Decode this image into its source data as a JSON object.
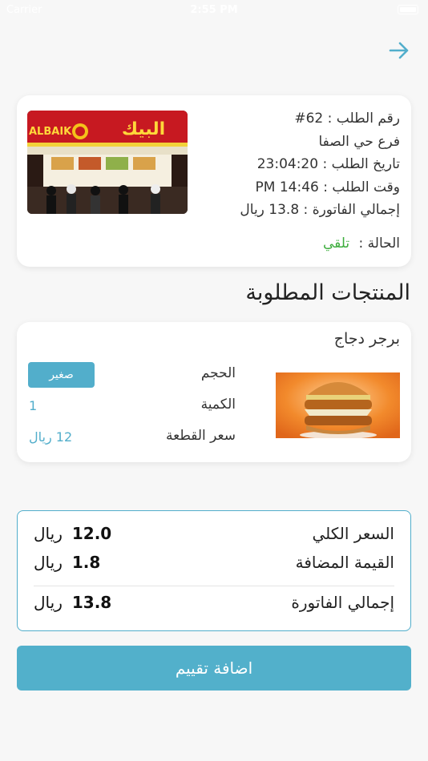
{
  "status_bar": {
    "carrier": "Carrier",
    "time": "2:55 PM"
  },
  "header": {
    "back_icon": "arrow-right-icon"
  },
  "order": {
    "number": "رقم الطلب : 62#",
    "branch": "فرع حي الصفا",
    "date": "تاريخ الطلب : 23:04:20",
    "time": "وقت الطلب : 14:46 PM",
    "total": "إجمالي الفاتورة : 13.8 ريال",
    "status_label": "الحالة :",
    "status_value": "تلقي",
    "status_color": "#3cad3c",
    "image_text": "البيك",
    "image_text_latin": "ALBAIK"
  },
  "products_section": {
    "title": "المنتجات المطلوبة"
  },
  "products": [
    {
      "name": "برجر دجاج",
      "size_label": "الحجم",
      "size_value": "صغير",
      "quantity_label": "الكمية",
      "quantity_value": "1",
      "unit_price_label": "سعر القطعة",
      "unit_price_value": "12 ريال"
    }
  ],
  "summary": {
    "subtotal_label": "السعر الكلي",
    "subtotal_value": "12.0",
    "vat_label": "القيمة المضافة",
    "vat_value": "1.8",
    "total_label": "إجمالي الفاتورة",
    "total_value": "13.8",
    "currency": "ريال"
  },
  "actions": {
    "rate_label": "اضافة تقييم"
  },
  "colors": {
    "accent": "#52aecb",
    "status_green": "#3cad3c"
  }
}
